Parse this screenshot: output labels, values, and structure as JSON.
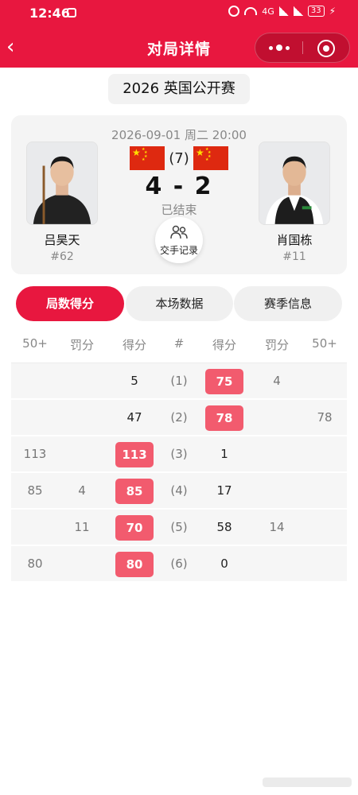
{
  "status_bar": {
    "time": "12:46",
    "network": "4G",
    "battery": "33"
  },
  "nav": {
    "back_glyph": "‹",
    "title": "对局详情"
  },
  "tournament": "2026 英国公开赛",
  "match": {
    "datetime": "2026-09-01 周二 20:00",
    "best_of": "(7)",
    "score": "4 - 2",
    "status": "已结束",
    "h2h_label": "交手记录",
    "player_left": {
      "name": "吕昊天",
      "rank": "#62",
      "flag": "china-flag"
    },
    "player_right": {
      "name": "肖国栋",
      "rank": "#11",
      "flag": "china-flag"
    }
  },
  "tabs": [
    {
      "label": "局数得分",
      "active": true
    },
    {
      "label": "本场数据",
      "active": false
    },
    {
      "label": "赛季信息",
      "active": false
    }
  ],
  "frames": {
    "headers": [
      "50+",
      "罚分",
      "得分",
      "#",
      "得分",
      "罚分",
      "50+"
    ],
    "rows": [
      {
        "l50": "",
        "lfoul": "",
        "lscore": "5",
        "frame": "(1)",
        "rscore": "75",
        "rfoul": "4",
        "r50": "",
        "winner": "right"
      },
      {
        "l50": "",
        "lfoul": "",
        "lscore": "47",
        "frame": "(2)",
        "rscore": "78",
        "rfoul": "",
        "r50": "78",
        "winner": "right"
      },
      {
        "l50": "113",
        "lfoul": "",
        "lscore": "113",
        "frame": "(3)",
        "rscore": "1",
        "rfoul": "",
        "r50": "",
        "winner": "left"
      },
      {
        "l50": "85",
        "lfoul": "4",
        "lscore": "85",
        "frame": "(4)",
        "rscore": "17",
        "rfoul": "",
        "r50": "",
        "winner": "left"
      },
      {
        "l50": "",
        "lfoul": "11",
        "lscore": "70",
        "frame": "(5)",
        "rscore": "58",
        "rfoul": "14",
        "r50": "",
        "winner": "left"
      },
      {
        "l50": "80",
        "lfoul": "",
        "lscore": "80",
        "frame": "(6)",
        "rscore": "0",
        "rfoul": "",
        "r50": "",
        "winner": "left"
      }
    ]
  },
  "colors": {
    "brand_red": "#e8173f",
    "win_badge": "#f25b6e",
    "card_bg": "#f4f4f4"
  }
}
